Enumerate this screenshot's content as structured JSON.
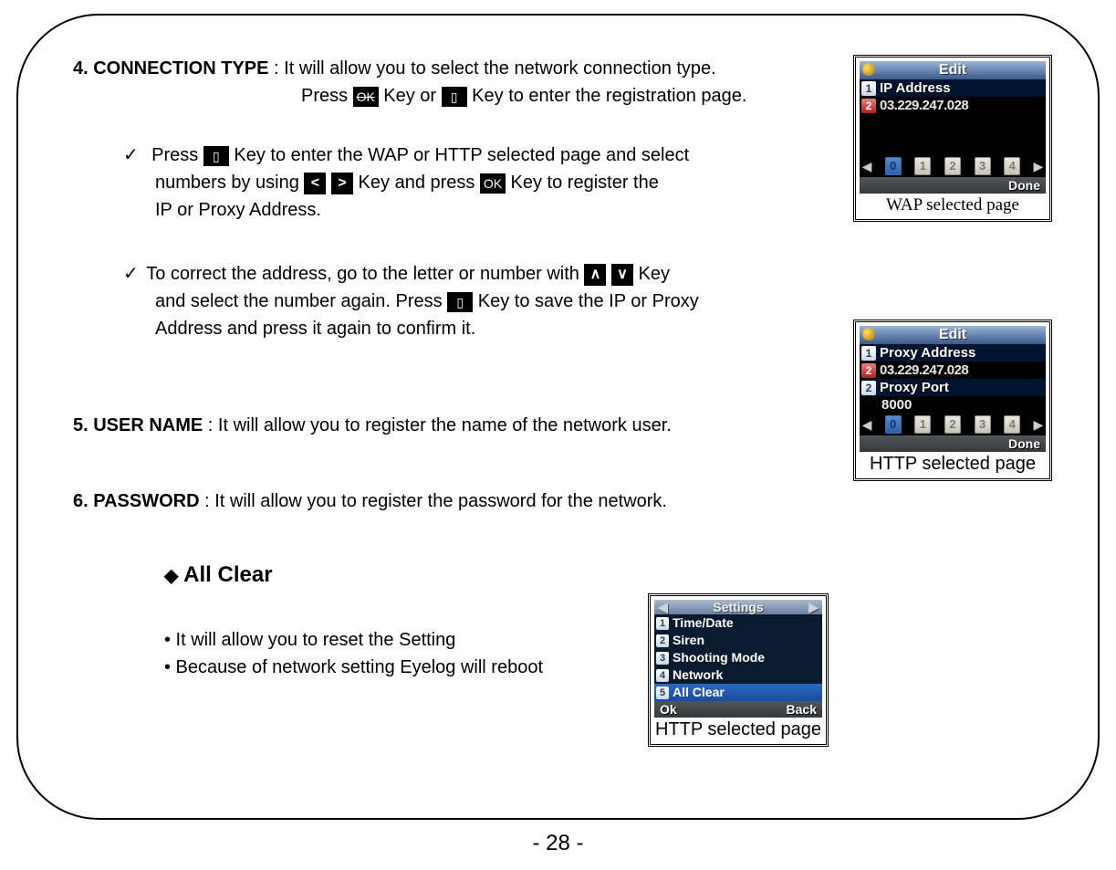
{
  "section4": {
    "heading": "4. CONNECTION TYPE",
    "line1a": " : It will allow you to select the network connection type.",
    "line1b_pre": "Press ",
    "line1b_mid": " Key or ",
    "line1b_post": " Key to enter the registration page.",
    "bullet1_pre": "Press ",
    "bullet1_mid1": " Key to enter the WAP or HTTP selected page and select",
    "bullet1_line2_pre": "numbers by using  ",
    "bullet1_line2_mid": "  Key and press ",
    "bullet1_line2_post": " Key to register the",
    "bullet1_line3": "IP or Proxy Address.",
    "bullet2_pre": "To correct the address, go to the letter or number with  ",
    "bullet2_post": " Key",
    "bullet2_line2_pre": "and select the number again. Press ",
    "bullet2_line2_post": " Key to save the IP or Proxy",
    "bullet2_line3": "Address and press it again to confirm it."
  },
  "section5": {
    "heading": "5. USER NAME",
    "text": " : It will allow you to register the name of the network user."
  },
  "section6": {
    "heading": "6. PASSWORD",
    "text": " : It will allow you to register the password for the network."
  },
  "allclear": {
    "title": "All Clear",
    "b1": "• It will allow you to reset the Setting",
    "b2": "• Because of network setting Eyelog will reboot"
  },
  "panel1": {
    "title": "Edit",
    "row1_label": "IP Address",
    "row2_value": "03.229.247.028",
    "digits": [
      "0",
      "1",
      "2",
      "3",
      "4"
    ],
    "softkey_right": "Done",
    "caption": "WAP selected page"
  },
  "panel2": {
    "title": "Edit",
    "row1_label": "Proxy Address",
    "row2_value": "03.229.247.028",
    "row3_label": "Proxy Port",
    "row3_value": "8000",
    "digits": [
      "0",
      "1",
      "2",
      "3",
      "4"
    ],
    "softkey_right": "Done",
    "caption": "HTTP selected page"
  },
  "panel3": {
    "title": "Settings",
    "items": [
      "Time/Date",
      "Siren",
      "Shooting Mode",
      "Network",
      "All Clear"
    ],
    "softkey_left": "Ok",
    "softkey_right": "Back",
    "caption": "HTTP selected page"
  },
  "keys": {
    "ok": "OK",
    "phone_glyph": "▯",
    "left": "<",
    "right": ">",
    "up": "∧",
    "down": "∨",
    "check": "✓",
    "diamond": "◆"
  },
  "page_number": "- 28 -"
}
